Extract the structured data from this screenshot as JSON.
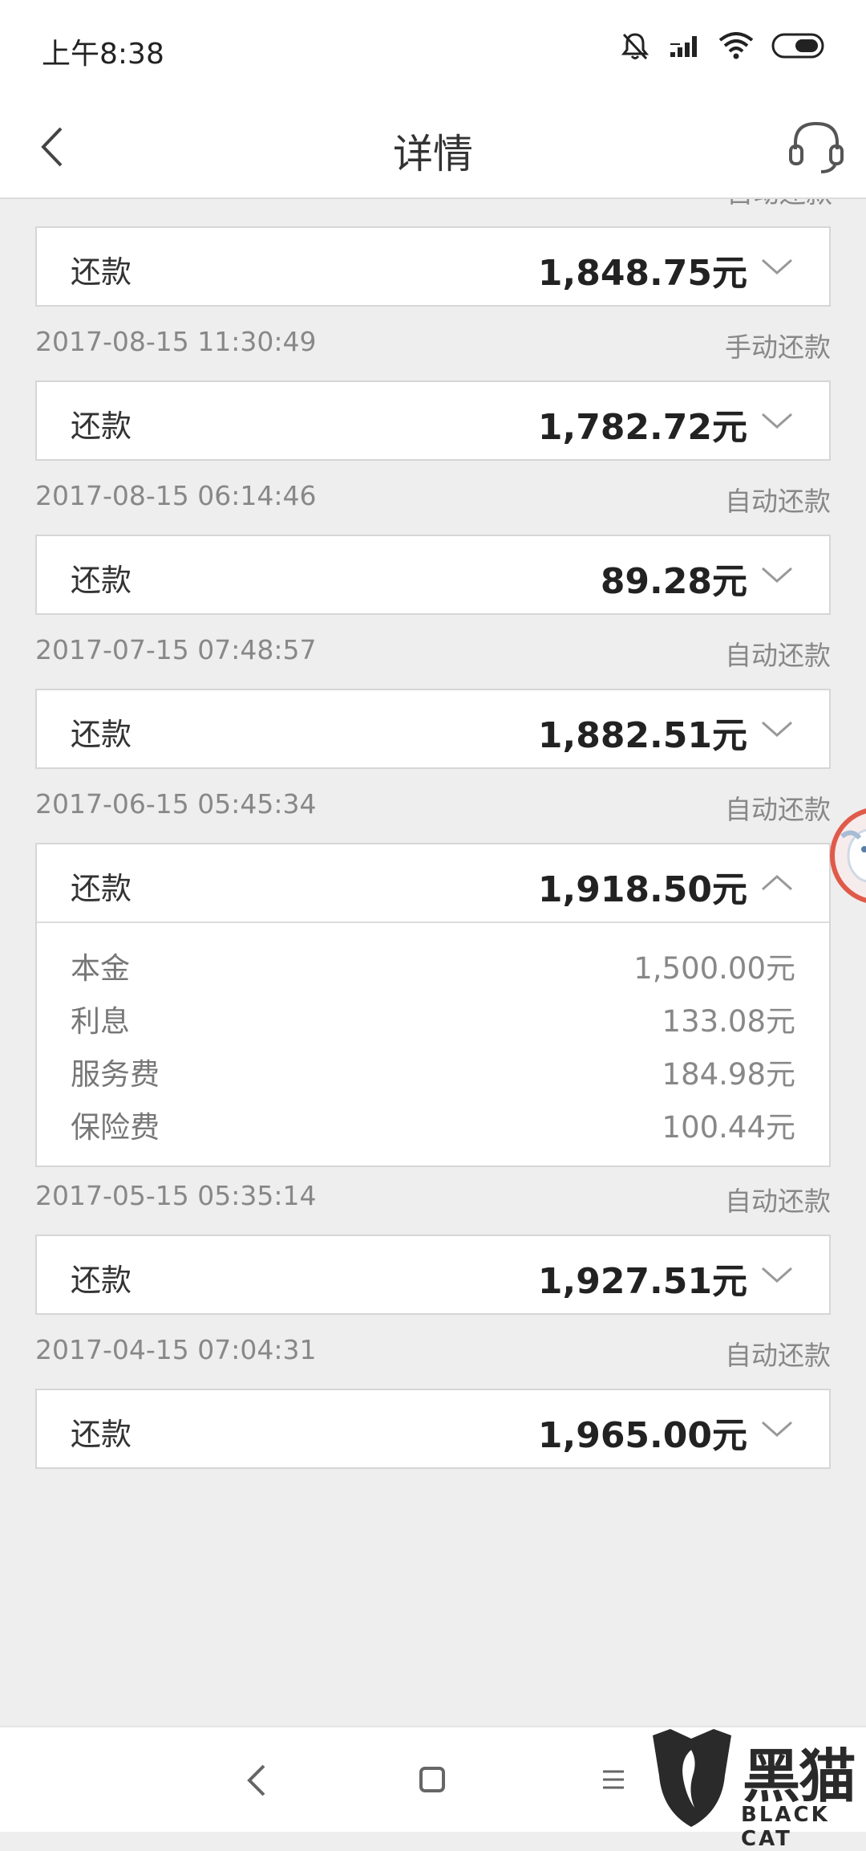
{
  "status_bar": {
    "time": "上午8:38",
    "icons": [
      "bell-muted-icon",
      "signal-icon",
      "wifi-icon",
      "battery-icon"
    ]
  },
  "header": {
    "title": "详情",
    "back_icon": "chevron-left-icon",
    "support_icon": "headset-icon"
  },
  "top_partial": {
    "mode": "自动还款"
  },
  "records": [
    {
      "date": "",
      "mode": "",
      "type": "还款",
      "amount": "1,848.75元",
      "expanded": false
    },
    {
      "date": "2017-08-15 11:30:49",
      "mode": "手动还款",
      "type": "还款",
      "amount": "1,782.72元",
      "expanded": false
    },
    {
      "date": "2017-08-15 06:14:46",
      "mode": "自动还款",
      "type": "还款",
      "amount": "89.28元",
      "expanded": false
    },
    {
      "date": "2017-07-15 07:48:57",
      "mode": "自动还款",
      "type": "还款",
      "amount": "1,882.51元",
      "expanded": false
    },
    {
      "date": "2017-06-15 05:45:34",
      "mode": "自动还款",
      "type": "还款",
      "amount": "1,918.50元",
      "expanded": true,
      "breakdown": [
        {
          "label": "本金",
          "value": "1,500.00元"
        },
        {
          "label": "利息",
          "value": "133.08元"
        },
        {
          "label": "服务费",
          "value": "184.98元"
        },
        {
          "label": "保险费",
          "value": "100.44元"
        }
      ]
    },
    {
      "date": "2017-05-15 05:35:14",
      "mode": "自动还款",
      "type": "还款",
      "amount": "1,927.51元",
      "expanded": false
    },
    {
      "date": "2017-04-15 07:04:31",
      "mode": "自动还款",
      "type": "还款",
      "amount": "1,965.00元",
      "expanded": false
    }
  ],
  "nav_bar": {
    "icons": [
      "back-triangle-icon",
      "home-square-icon",
      "menu-lines-icon"
    ]
  },
  "watermark": {
    "cn": "黑猫",
    "en": "BLACK CAT"
  },
  "colors": {
    "background": "#eeeeee",
    "card": "#ffffff",
    "muted_text": "#888888"
  }
}
